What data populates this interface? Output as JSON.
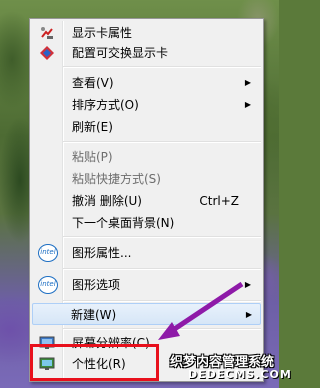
{
  "menu": {
    "items": [
      {
        "label": "显示卡属性",
        "icon": "display-card-icon"
      },
      {
        "label": "配置可交换显示卡",
        "icon": "switchable-graphics-icon"
      },
      {
        "label": "查看(V)",
        "submenu": true
      },
      {
        "label": "排序方式(O)",
        "submenu": true
      },
      {
        "label": "刷新(E)"
      },
      {
        "label": "粘贴(P)",
        "disabled": true
      },
      {
        "label": "粘贴快捷方式(S)",
        "disabled": true
      },
      {
        "label": "撤消 删除(U)",
        "shortcut": "Ctrl+Z"
      },
      {
        "label": "下一个桌面背景(N)"
      },
      {
        "label": "图形属性...",
        "icon": "intel-icon"
      },
      {
        "label": "图形选项",
        "icon": "intel-icon",
        "submenu": true
      },
      {
        "label": "新建(W)",
        "submenu": true,
        "highlighted": true
      },
      {
        "label": "屏幕分辨率(C)",
        "icon": "screen-resolution-icon"
      },
      {
        "label": "个性化(R)",
        "icon": "personalize-icon"
      }
    ],
    "intel_text": "intel"
  },
  "watermark": {
    "line1": "织梦内容管理系统",
    "line2": "DEDECMS.COM"
  },
  "colors": {
    "highlight_box": "#e8101c",
    "arrow": "#8e1aa8",
    "intel_blue": "#1e6fc3"
  }
}
